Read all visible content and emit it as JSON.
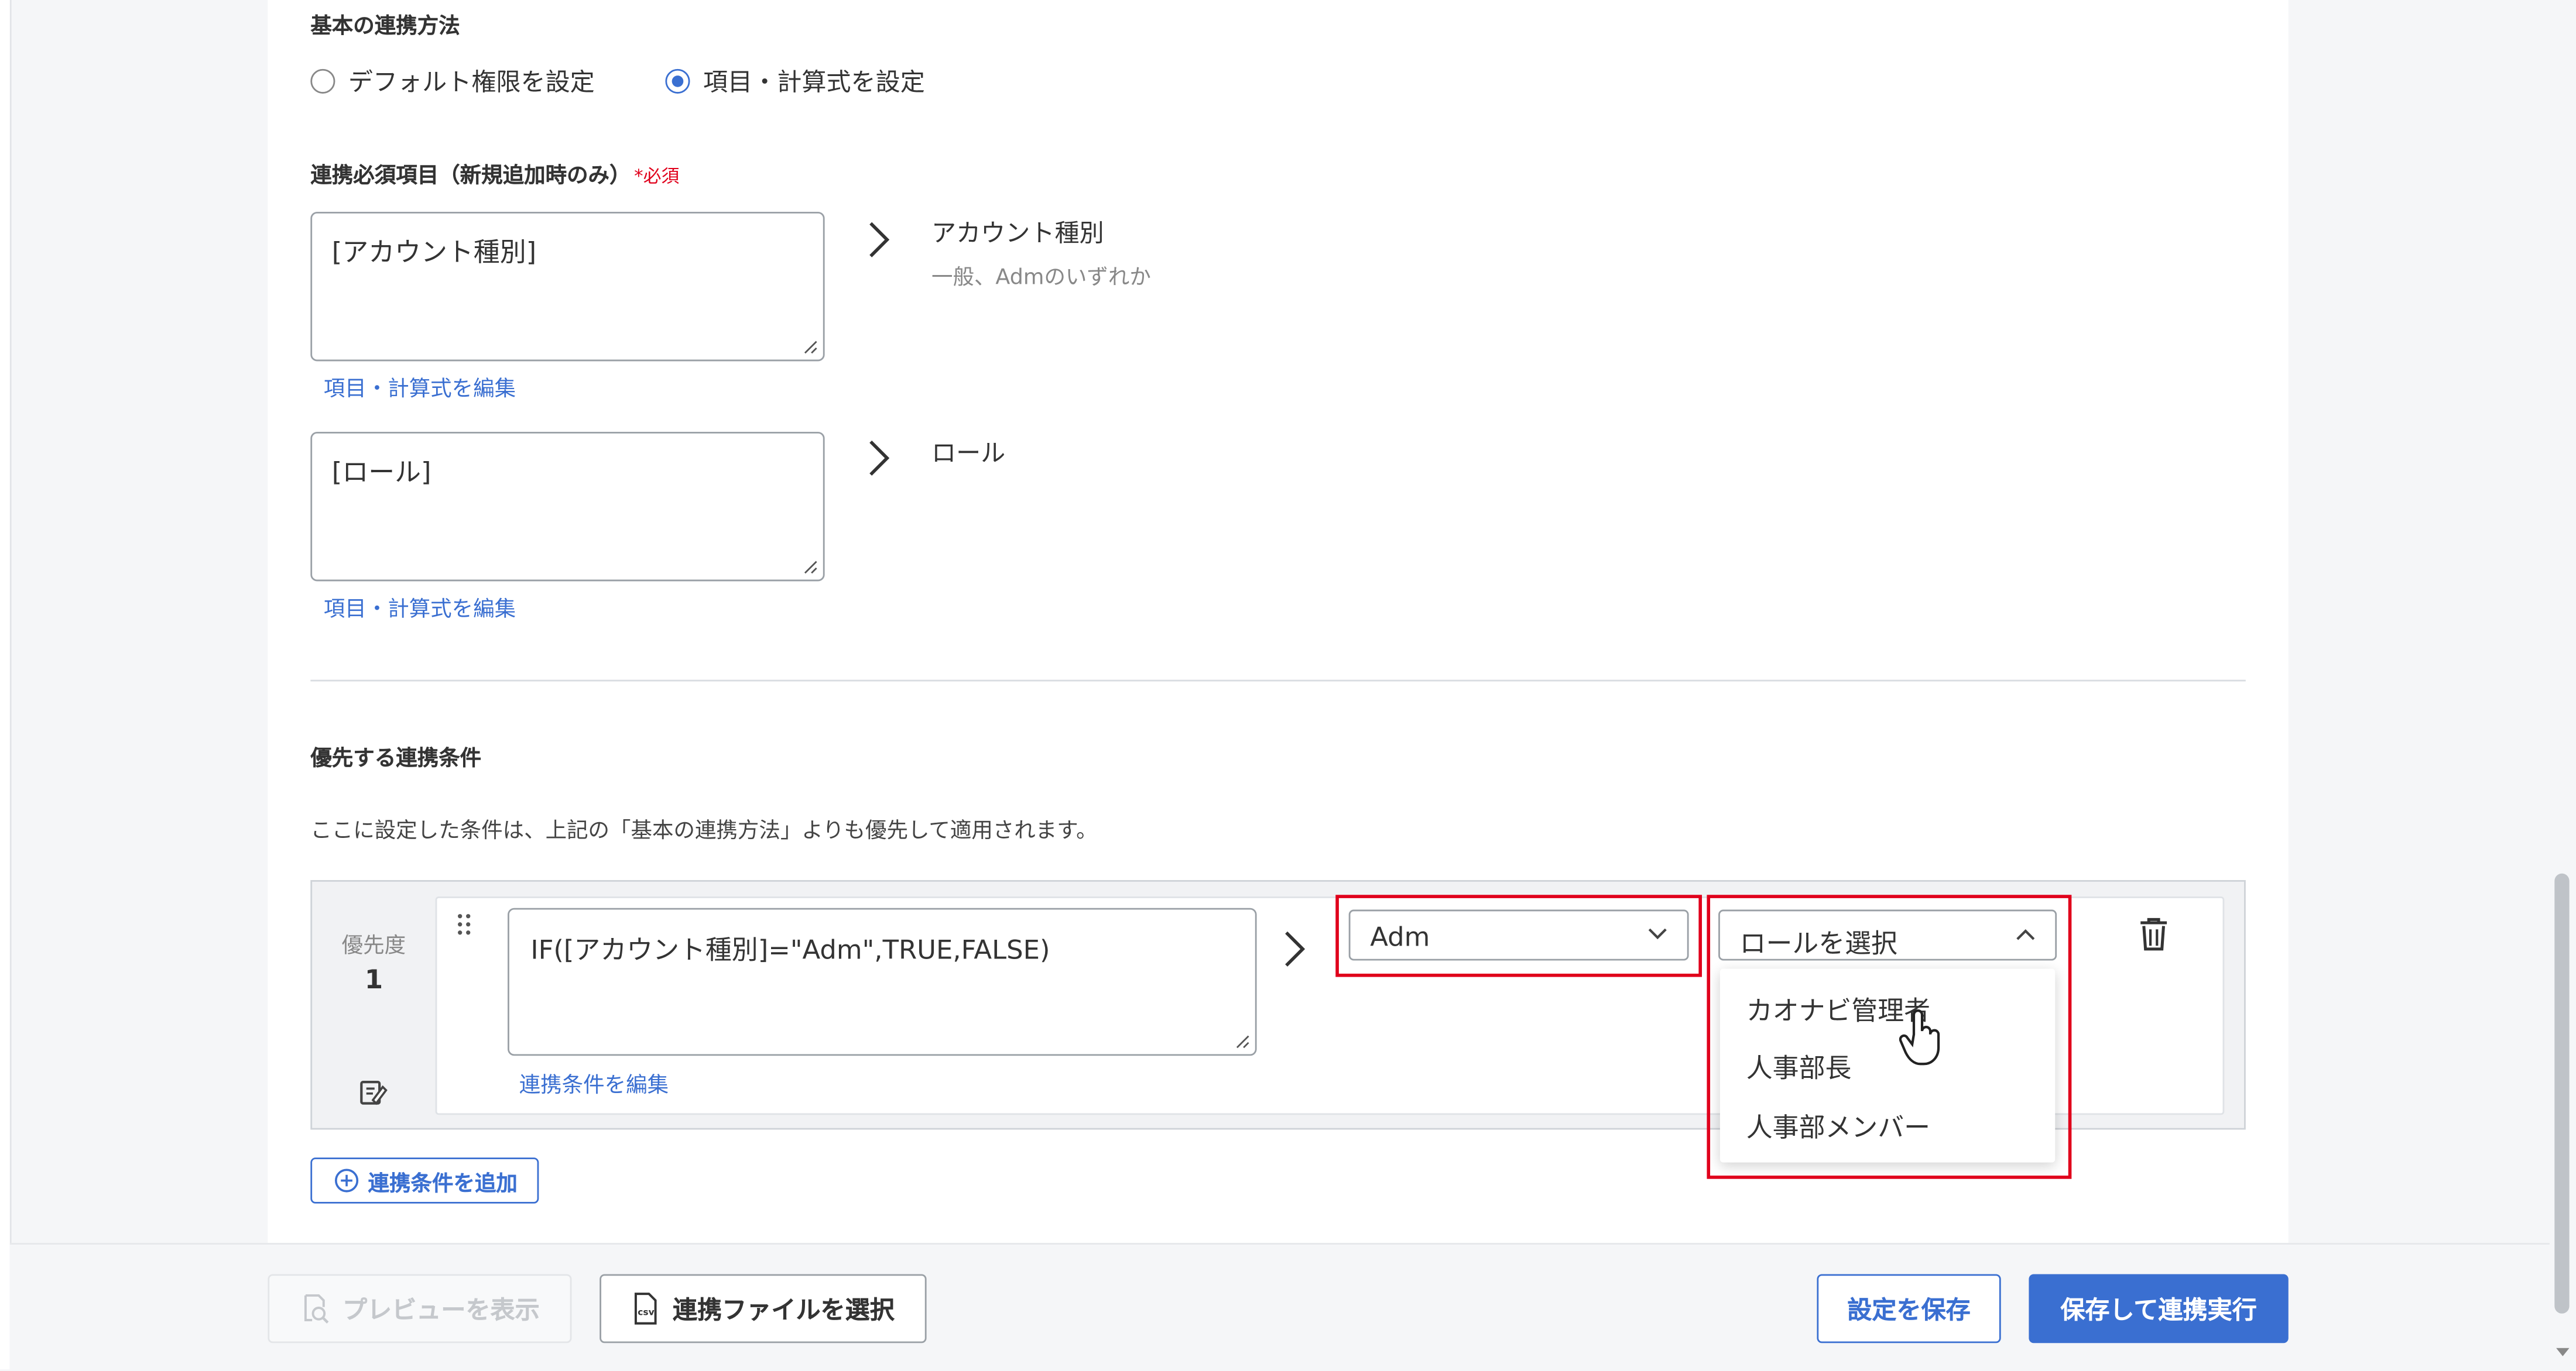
{
  "basic": {
    "title": "基本の連携方法",
    "options": [
      "デフォルト権限を設定",
      "項目・計算式を設定"
    ],
    "selected_index": 1
  },
  "required": {
    "title": "連携必須項目（新規追加時のみ）",
    "required_mark": "*必須",
    "fields": [
      {
        "value": "[アカウント種別]",
        "edit_link": "項目・計算式を編集",
        "target": "アカウント種別",
        "target_sub": "一般、Admのいずれか"
      },
      {
        "value": "[ロール]",
        "edit_link": "項目・計算式を編集",
        "target": "ロール",
        "target_sub": ""
      }
    ]
  },
  "priority": {
    "title": "優先する連携条件",
    "description": "ここに設定した条件は、上記の「基本の連携方法」よりも優先して適用されます。",
    "rules": [
      {
        "priority_label": "優先度",
        "priority_value": "1",
        "formula": "IF([アカウント種別]=\"Adm\",TRUE,FALSE)",
        "edit_link": "連携条件を編集",
        "account_value": "Adm",
        "role_placeholder": "ロールを選択",
        "role_options": [
          "カオナビ管理者",
          "人事部長",
          "人事部メンバー"
        ]
      }
    ],
    "add_button": "連携条件を追加"
  },
  "footer": {
    "preview_button": "プレビューを表示",
    "select_file_button": "連携ファイルを選択",
    "save_button": "設定を保存",
    "save_run_button": "保存して連携実行"
  },
  "colors": {
    "accent": "#3a6fd1",
    "highlight": "#e0001b"
  }
}
